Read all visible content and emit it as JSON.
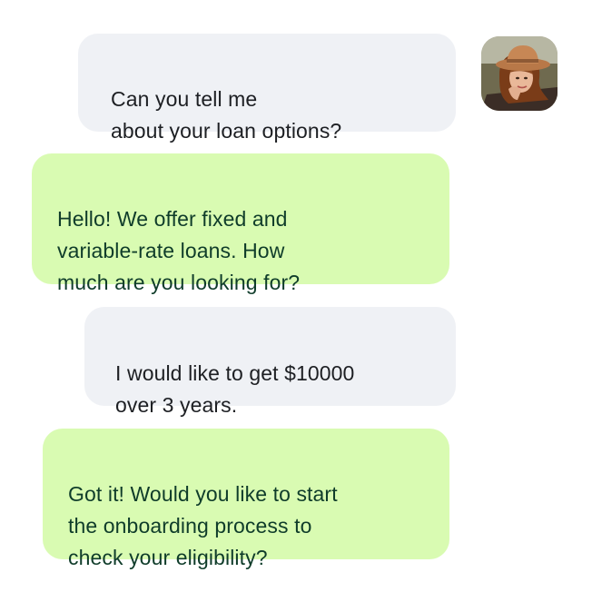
{
  "conversation": {
    "messages": [
      {
        "sender": "user",
        "text": "Can you tell me\nabout your loan options?"
      },
      {
        "sender": "bot",
        "text": "Hello! We offer fixed and\nvariable-rate loans. How\nmuch are you looking for?"
      },
      {
        "sender": "user",
        "text": "I would like to get $10000\nover 3 years."
      },
      {
        "sender": "bot",
        "text": "Got it! Would you like to start\nthe onboarding process to\ncheck your eligibility?"
      }
    ],
    "user_avatar": {
      "icon": "user-avatar-woman-hat-photo"
    }
  },
  "colors": {
    "user_bubble": "#eff1f5",
    "bot_bubble": "#d9fbb2",
    "user_text": "#1d1f23",
    "bot_text": "#0f3c2a",
    "background": "#ffffff"
  }
}
